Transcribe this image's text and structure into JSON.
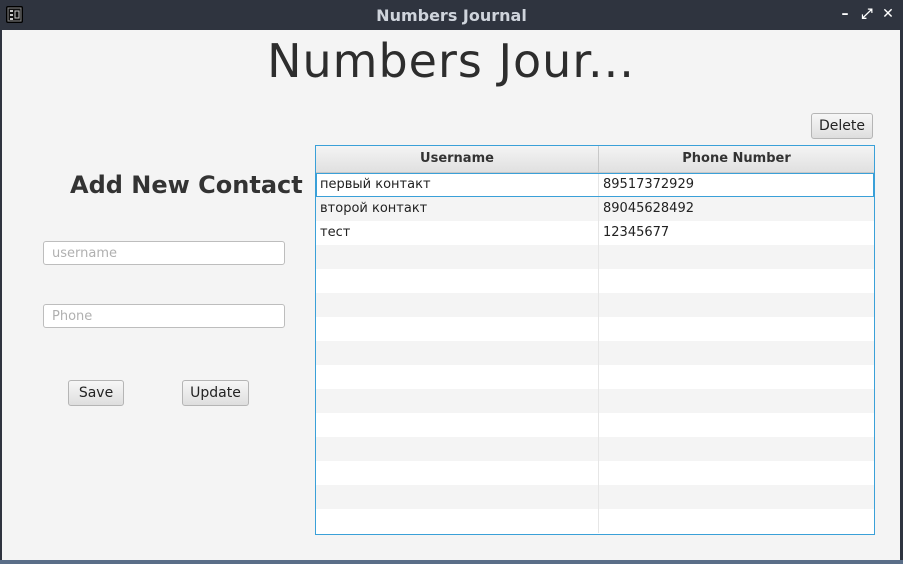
{
  "window": {
    "title": "Numbers Journal",
    "controls": {
      "minimize": "–",
      "maximize": "⤢",
      "close": "✕"
    }
  },
  "header": {
    "title": "Numbers Jour..."
  },
  "form": {
    "heading": "Add New Contact",
    "username_placeholder": "username",
    "username_value": "",
    "phone_placeholder": "Phone",
    "phone_value": "",
    "save_label": "Save",
    "update_label": "Update"
  },
  "toolbar": {
    "delete_label": "Delete"
  },
  "table": {
    "columns": [
      "Username",
      "Phone Number"
    ],
    "rows": [
      {
        "username": "первый контакт",
        "phone": "89517372929"
      },
      {
        "username": "второй контакт",
        "phone": "89045628492"
      },
      {
        "username": "тест",
        "phone": "12345677"
      }
    ],
    "empty_rows": 12
  },
  "colors": {
    "accent": "#3aa0d8",
    "titlebar": "#2f343f",
    "background": "#f4f4f4"
  }
}
